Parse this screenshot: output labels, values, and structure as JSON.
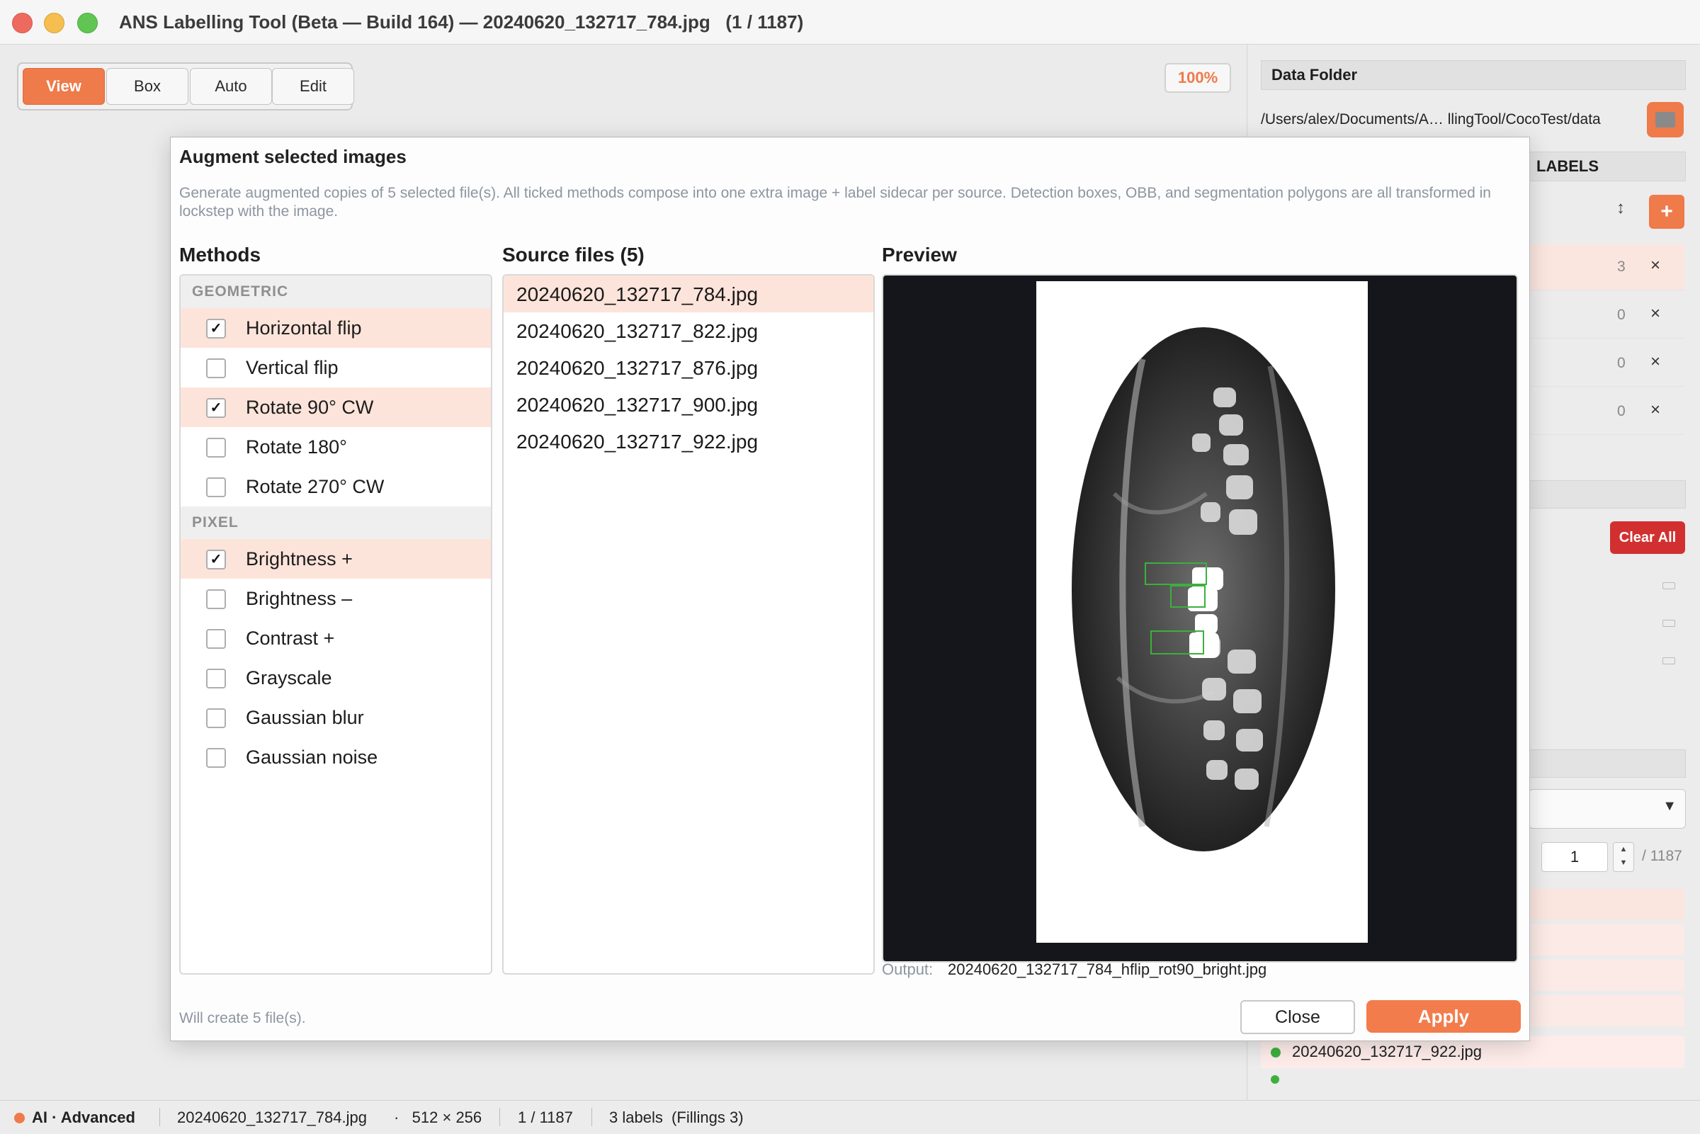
{
  "window": {
    "title": "ANS Labelling Tool (Beta — Build 164) — 20240620_132717_784.jpg   (1 / 1187)"
  },
  "toolbar": {
    "modes": [
      "View",
      "Box",
      "Auto",
      "Edit"
    ],
    "active_mode": "View",
    "zoom": "100%"
  },
  "right_panel": {
    "data_folder_title": "Data Folder",
    "folder_path": "/Users/alex/Documents/A… llingTool/CocoTest/data",
    "labels_title": "LABELS",
    "label_rows": [
      {
        "count": "3"
      },
      {
        "count": "0"
      },
      {
        "count": "0"
      },
      {
        "count": "0"
      }
    ],
    "clear_all": "Clear All",
    "page_input": "1",
    "page_total": "/ 1187",
    "visible_file": "20240620_132717_922.jpg"
  },
  "dialog": {
    "title": "Augment selected images",
    "description": "Generate augmented copies of 5 selected file(s). All ticked methods compose into one extra image + label sidecar per source. Detection boxes, OBB, and segmentation polygons are all transformed in lockstep with the image.",
    "methods_header": "Methods",
    "sources_header": "Source files (5)",
    "preview_header": "Preview",
    "method_groups": [
      {
        "name": "GEOMETRIC",
        "items": [
          {
            "label": "Horizontal flip",
            "checked": true
          },
          {
            "label": "Vertical flip",
            "checked": false
          },
          {
            "label": "Rotate 90° CW",
            "checked": true
          },
          {
            "label": "Rotate 180°",
            "checked": false
          },
          {
            "label": "Rotate 270° CW",
            "checked": false
          }
        ]
      },
      {
        "name": "PIXEL",
        "items": [
          {
            "label": "Brightness +",
            "checked": true
          },
          {
            "label": "Brightness –",
            "checked": false
          },
          {
            "label": "Contrast +",
            "checked": false
          },
          {
            "label": "Grayscale",
            "checked": false
          },
          {
            "label": "Gaussian blur",
            "checked": false
          },
          {
            "label": "Gaussian noise",
            "checked": false
          }
        ]
      }
    ],
    "source_files": [
      "20240620_132717_784.jpg",
      "20240620_132717_822.jpg",
      "20240620_132717_876.jpg",
      "20240620_132717_900.jpg",
      "20240620_132717_922.jpg"
    ],
    "selected_source": "20240620_132717_784.jpg",
    "output_label": "Output:",
    "output_name": "20240620_132717_784_hflip_rot90_bright.jpg",
    "will_create": "Will create 5 file(s).",
    "close_label": "Close",
    "apply_label": "Apply"
  },
  "status": {
    "mode": "AI · Advanced",
    "file": "20240620_132717_784.jpg",
    "size": "·   512 × 256",
    "position": "1 / 1187",
    "labels": "3 labels  (Fillings 3)"
  },
  "colors": {
    "accent": "#ef7a4a",
    "selected_row": "#fde4da",
    "danger": "#d23030",
    "preview_bg": "#14161c",
    "box_green": "#3cb03c"
  },
  "icons": {
    "folder": "folder-icon",
    "plus": "plus-icon",
    "sort": "sort-icon",
    "close": "close-icon",
    "chevron": "chevron-down-icon"
  }
}
